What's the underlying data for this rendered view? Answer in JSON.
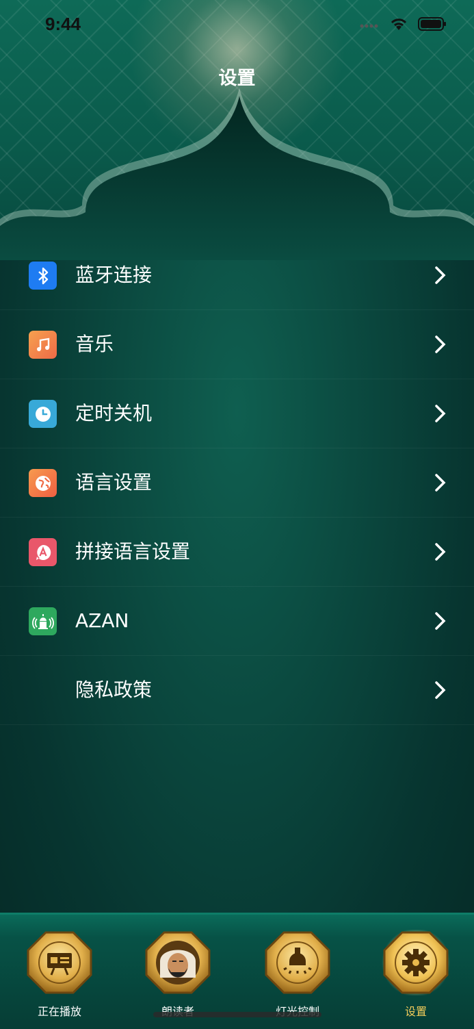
{
  "status_bar": {
    "time": "9:44"
  },
  "header": {
    "title": "设置"
  },
  "menu": {
    "items": [
      {
        "label": "蓝牙连接",
        "icon": "bluetooth-icon",
        "color": "#1e7cf2"
      },
      {
        "label": "音乐",
        "icon": "music-note-icon",
        "color": "#f0874a"
      },
      {
        "label": "定时关机",
        "icon": "clock-icon",
        "color": "#38a9d8"
      },
      {
        "label": "语言设置",
        "icon": "globe-icon",
        "color": "#f27a45"
      },
      {
        "label": "拼接语言设置",
        "icon": "letter-a-icon",
        "color": "#e9576a"
      },
      {
        "label": "AZAN",
        "icon": "mosque-broadcast-icon",
        "color": "#2ea85e"
      },
      {
        "label": "隐私政策",
        "icon": "",
        "color": ""
      }
    ]
  },
  "tabbar": {
    "tabs": [
      {
        "label": "正在播放",
        "icon": "presentation-board-icon",
        "active": false
      },
      {
        "label": "朗读者",
        "icon": "reader-avatar-icon",
        "active": false
      },
      {
        "label": "灯光控制",
        "icon": "lamp-icon",
        "active": false
      },
      {
        "label": "设置",
        "icon": "gear-icon",
        "active": true
      }
    ]
  },
  "colors": {
    "accent_gold": "#f2cc5a",
    "background": "#0b4a40"
  }
}
